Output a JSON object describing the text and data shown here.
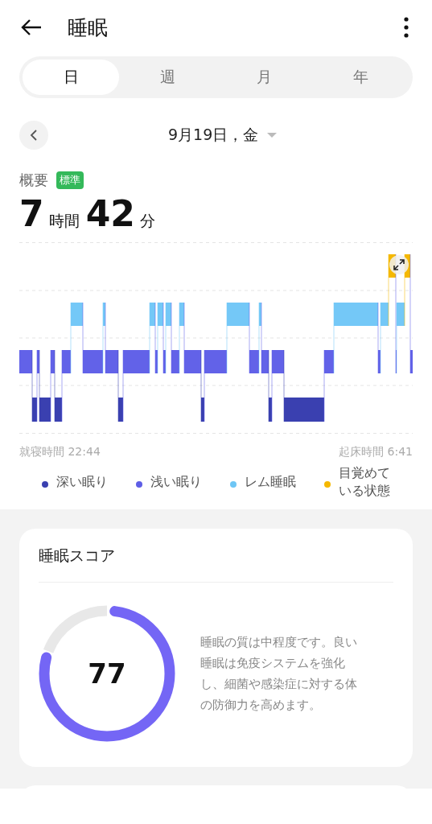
{
  "header": {
    "title": "睡眠"
  },
  "tabs": [
    {
      "label": "日",
      "selected": true
    },
    {
      "label": "週",
      "selected": false
    },
    {
      "label": "月",
      "selected": false
    },
    {
      "label": "年",
      "selected": false
    }
  ],
  "date": {
    "label": "9月19日，金"
  },
  "summary": {
    "label": "概要",
    "badge": "標準",
    "hours": "7",
    "hours_unit": "時間",
    "minutes": "42",
    "minutes_unit": "分"
  },
  "hypnogram": {
    "bedtime": "就寝時間 22:44",
    "wake_time": "起床時間 6:41"
  },
  "legend": [
    {
      "label": "深い眠り",
      "color": "#3a40b0"
    },
    {
      "label": "浅い眠り",
      "color": "#5e5ee6"
    },
    {
      "label": "レム睡眠",
      "color": "#6ec6f5"
    },
    {
      "label": "目覚めている状態",
      "color": "#f5b800"
    }
  ],
  "score_card": {
    "title": "睡眠スコア",
    "score": "77",
    "level": 0.77,
    "description": "睡眠の質は中程度です。良い睡眠は免疫システムを強化し、細菌や感染症に対する体の防御力を高めます。"
  }
}
